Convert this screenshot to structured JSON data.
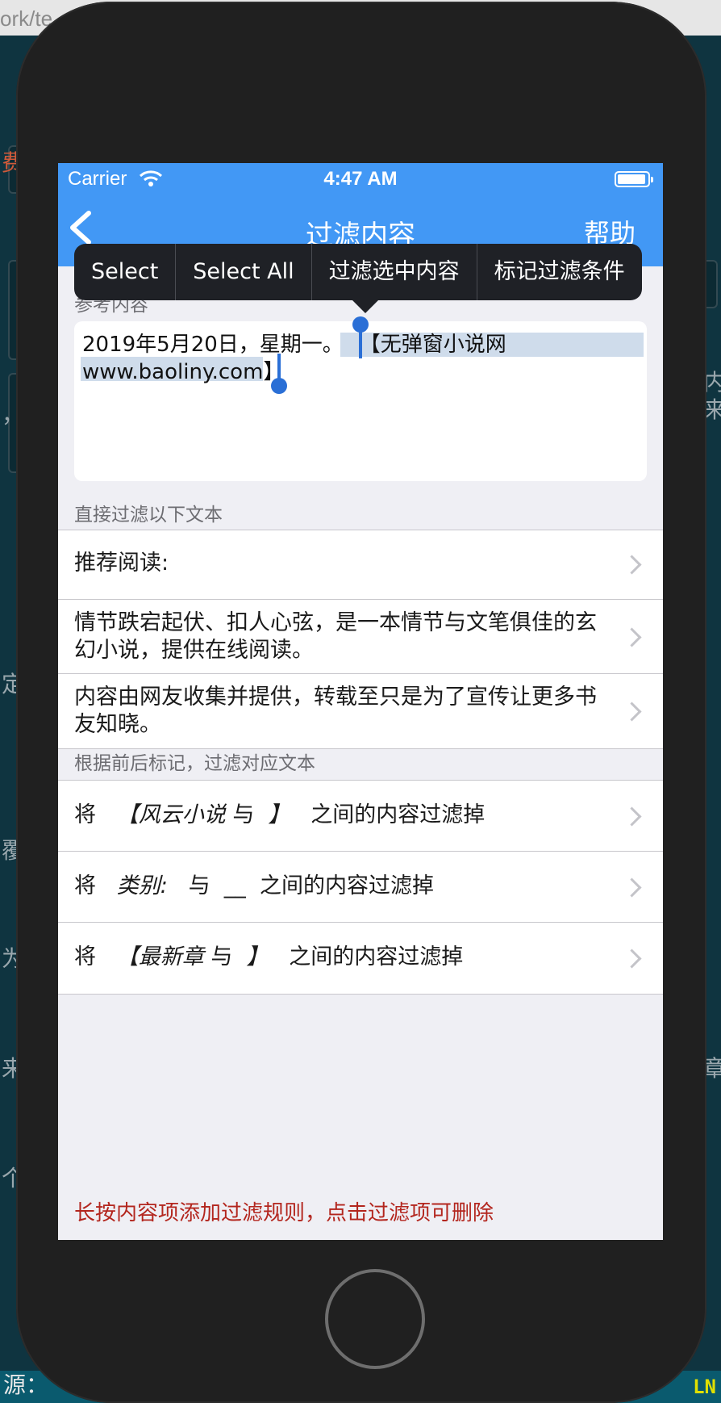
{
  "background": {
    "url_fragment": "ork/te",
    "left_fragments": [
      "费",
      "，",
      "定",
      "覆",
      "为",
      "来",
      "个"
    ],
    "right_fragments": [
      "内",
      "来",
      "章"
    ],
    "bottom_left": "源：",
    "bottom_right": "LN"
  },
  "status_bar": {
    "carrier": "Carrier",
    "time": "4:47 AM"
  },
  "nav": {
    "title": "过滤内容",
    "help": "帮助"
  },
  "edit_menu": {
    "items": [
      "Select",
      "Select All",
      "过滤选中内容",
      "标记过滤条件"
    ]
  },
  "reference": {
    "label": "参考内容",
    "line1_plain": "2019年5月20日，星期一。",
    "line1_selected": "【无弹窗小说网",
    "line2_selected": "www.baoliny.com】"
  },
  "direct_filter": {
    "label": "直接过滤以下文本",
    "rows": [
      "推荐阅读:",
      "情节跌宕起伏、扣人心弦，是一本情节与文笔俱佳的玄幻小说，提供在线阅读。",
      "内容由网友收集并提供，转载至只是为了宣传让更多书友知晓。"
    ]
  },
  "marker_filter": {
    "label": "根据前后标记，过滤对应文本",
    "rows": [
      {
        "prefix": "将",
        "start": "【风云小说",
        "conj": "与",
        "end": "】",
        "suffix": "之间的内容过滤掉"
      },
      {
        "prefix": "将",
        "start": "类别:",
        "conj": "与",
        "end": "__",
        "suffix": "之间的内容过滤掉"
      },
      {
        "prefix": "将",
        "start": "【最新章",
        "conj": "与",
        "end": "】",
        "suffix": "之间的内容过滤掉"
      }
    ]
  },
  "footer_note": "长按内容项添加过滤规则，点击过滤项可删除",
  "colors": {
    "nav_blue": "#4298f5",
    "selection_blue": "#2a6fd6",
    "footer_red": "#b3261e"
  }
}
